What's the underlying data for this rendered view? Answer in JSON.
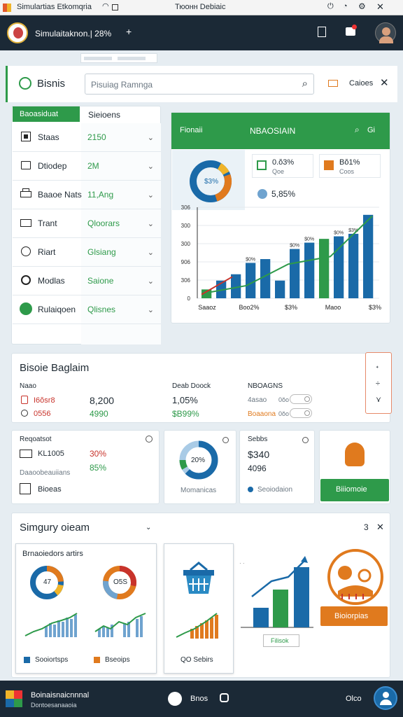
{
  "os_bar": {
    "title": "Simulartias Etkomqria",
    "center": "Тюонн Debiaic"
  },
  "app_bar": {
    "title": "Simulaitaknon.| 28%"
  },
  "top_tabs": [
    "",
    ""
  ],
  "header": {
    "app_name": "Bisnis",
    "search_placeholder": "Pisuiag Ramnga",
    "action_label": "Caioes"
  },
  "sidebar": {
    "header": "Baoasiduat",
    "col2": "Sieioens",
    "items": [
      {
        "label": "Staas",
        "value": "2150",
        "icon": "grid-icon"
      },
      {
        "label": "Dtiodep",
        "value": "2M",
        "icon": "folder-icon"
      },
      {
        "label": "Baaoe Nats",
        "value": "11,Ang",
        "icon": "printer-icon"
      },
      {
        "label": "Trant",
        "value": "Qloorars",
        "icon": "mail-icon"
      },
      {
        "label": "Riart",
        "value": "Glsiang",
        "icon": "clock-icon"
      },
      {
        "label": "Modlas",
        "value": "Saione",
        "icon": "settings-icon"
      },
      {
        "label": "Rulaiqoen",
        "value": "Qlisnes",
        "icon": "avatar-icon"
      }
    ]
  },
  "overview": {
    "header_left": "Fionaii",
    "header_center": "NBAOSIAIN",
    "header_right": "Gi",
    "stat1": {
      "value": "0.ŏ3%",
      "sub": "Qoe"
    },
    "stat2": {
      "value": "Bŏ1%",
      "sub": "Coos"
    },
    "stat3": {
      "value": "5,85%"
    },
    "donut_label": "$3%",
    "chart_data": {
      "type": "bar",
      "categories": [
        "Saaoz",
        "Boo2%",
        "$3%",
        "Maoo",
        "$3%"
      ],
      "ytick_labels": [
        "0",
        "306",
        "906",
        "300",
        "300",
        "306"
      ],
      "series": [
        {
          "values": [
            70,
            140,
            190,
            280,
            310,
            140,
            390,
            440,
            470,
            490,
            510,
            660
          ]
        },
        {
          "values": [
            40,
            100,
            270,
            330,
            650
          ]
        }
      ],
      "bar_labels": [
        "",
        "",
        "",
        "$0%",
        "",
        "",
        "$0%",
        "$0%",
        "",
        "$0%",
        "$3%",
        ""
      ],
      "ylim": [
        0,
        720
      ]
    }
  },
  "summary": {
    "title": "Bisoie Baglaim",
    "col1_header": "Naao",
    "col1_row1": "I6ŏsr8",
    "col1_row2": "0556",
    "col2_row1": "8,200",
    "col2_row2": "4990",
    "col3_header": "Deab Doock",
    "col3_row1": "1,05%",
    "col3_row2": "$B99%",
    "col4_header": "NBOAGNS",
    "col4_row1_a": "4asao",
    "col4_row1_b": "0ŏo",
    "col4_row2_a": "Boaaona",
    "col4_row2_b": "0ŏo"
  },
  "kpis": {
    "card1": {
      "title": "Reqoatsot",
      "line1": "KL1005",
      "line2": "Daaoobeauiians",
      "line3": "Bioeas",
      "v1": "30%",
      "v2": "85%"
    },
    "card2": {
      "donut": "20%",
      "caption": "Momanicas"
    },
    "card3": {
      "title": "Sebbs",
      "v1": "$340",
      "v2": "4096",
      "caption": "Seoiodaion"
    },
    "card4": {
      "button": "Biiiomoie"
    }
  },
  "section": {
    "title": "Simgury oieam",
    "card1": {
      "title": "Brnaoiedors artirs",
      "donut1": "47",
      "donut2": "O5S",
      "leg1": "Sooiortsps",
      "leg2": "Bseoips"
    },
    "card2": {
      "caption": "QO Sebirs"
    },
    "card3": {
      "button": "Filisok"
    },
    "card4": {
      "button": "Bioiorpias"
    }
  },
  "taskbar": {
    "label1": "Boinaisnaicnnnal",
    "label2": "Dontoesanaaoia",
    "center": "Bnos",
    "right": "Olco"
  },
  "colors": {
    "accent": "#2e9a4a",
    "blue": "#1a6aa8",
    "orange": "#e07a1e",
    "dark": "#1b2936"
  }
}
